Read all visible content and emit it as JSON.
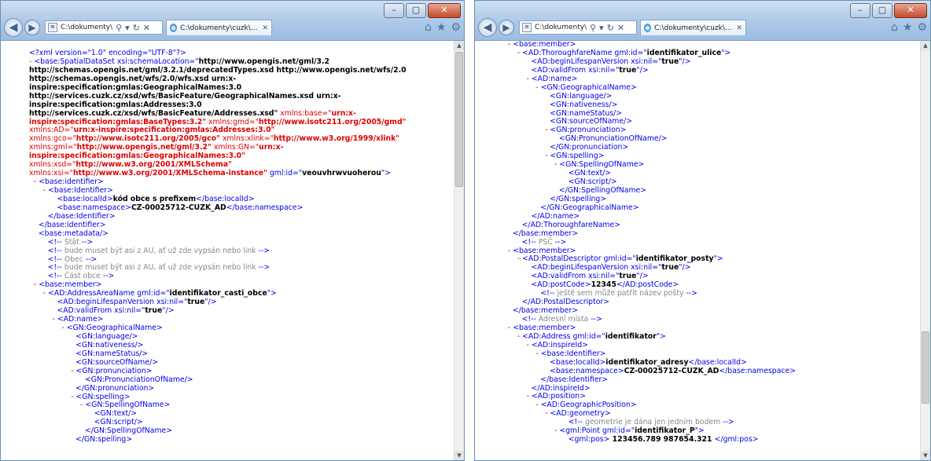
{
  "windows": {
    "left": {
      "address": "C:\\dokumenty\\",
      "tab_label": "C:\\dokumenty\\cuzk\\...",
      "lines": [
        [
          {
            "t": "<?xml version=\"1.0\" encoding=\"UTF-8\"?>",
            "c": "t"
          }
        ],
        [
          {
            "t": "- ",
            "c": "m"
          },
          {
            "t": "<base:SpatialDataSet xsi:schemaLocation=\"",
            "c": "t"
          },
          {
            "t": "http://www.opengis.net/gml/3.2",
            "c": "v"
          }
        ],
        [
          {
            "t": "http://schemas.opengis.net/gml/3.2.1/deprecatedTypes.xsd http://www.opengis.net/wfs/2.0",
            "c": "v"
          }
        ],
        [
          {
            "t": "http://schemas.opengis.net/wfs/2.0/wfs.xsd urn:x-",
            "c": "v"
          }
        ],
        [
          {
            "t": "inspire:specification:gmlas:GeographicalNames:3.0",
            "c": "v"
          }
        ],
        [
          {
            "t": "http://services.cuzk.cz/xsd/wfs/BasicFeature/GeographicalNames.xsd urn:x-",
            "c": "v"
          }
        ],
        [
          {
            "t": "inspire:specification:gmlas:Addresses:3.0",
            "c": "v"
          }
        ],
        [
          {
            "t": "http://services.cuzk.cz/xsd/wfs/BasicFeature/Addresses.xsd\"",
            "c": "v"
          },
          {
            "t": " xmlns:base=\"",
            "c": "m"
          },
          {
            "t": "urn:x-",
            "c": "a"
          }
        ],
        [
          {
            "t": "inspire:specification:gmlas:BaseTypes:3.2\"",
            "c": "a"
          },
          {
            "t": " xmlns:gmd=\"",
            "c": "m"
          },
          {
            "t": "http://www.isotc211.org/2005/gmd\"",
            "c": "a"
          }
        ],
        [
          {
            "t": "xmlns:AD=\"",
            "c": "m"
          },
          {
            "t": "urn:x-inspire:specification:gmlas:Addresses:3.0\"",
            "c": "a"
          }
        ],
        [
          {
            "t": "xmlns:gco=\"",
            "c": "m"
          },
          {
            "t": "http://www.isotc211.org/2005/gco\"",
            "c": "a"
          },
          {
            "t": " xmlns:xlink=\"",
            "c": "m"
          },
          {
            "t": "http://www.w3.org/1999/xlink\"",
            "c": "a"
          }
        ],
        [
          {
            "t": "xmlns:gml=\"",
            "c": "m"
          },
          {
            "t": "http://www.opengis.net/gml/3.2\"",
            "c": "a"
          },
          {
            "t": " xmlns:GN=\"",
            "c": "m"
          },
          {
            "t": "urn:x-",
            "c": "a"
          }
        ],
        [
          {
            "t": "inspire:specification:gmlas:GeographicalNames:3.0\"",
            "c": "a"
          }
        ],
        [
          {
            "t": "xmlns:xsd=\"",
            "c": "m"
          },
          {
            "t": "http://www.w3.org/2001/XMLSchema\"",
            "c": "a"
          }
        ],
        [
          {
            "t": "xmlns:xsi=\"",
            "c": "m"
          },
          {
            "t": "http://www.w3.org/2001/XMLSchema-instance\"",
            "c": "a"
          },
          {
            "t": " gml:id=\"",
            "c": "t"
          },
          {
            "t": "veouvhrwvuoherou",
            "c": "v"
          },
          {
            "t": "\">",
            "c": "t"
          }
        ],
        [
          {
            "t": "  - ",
            "c": "m"
          },
          {
            "t": "<base:identifier>",
            "c": "t"
          }
        ],
        [
          {
            "t": "      - ",
            "c": "m"
          },
          {
            "t": "<base:Identifier>",
            "c": "t"
          }
        ],
        [
          {
            "t": "            <base:localId>",
            "c": "t"
          },
          {
            "t": "kód obce s prefixem",
            "c": "v"
          },
          {
            "t": "</base:localId>",
            "c": "t"
          }
        ],
        [
          {
            "t": "            <base:namespace>",
            "c": "t"
          },
          {
            "t": "CZ-00025712-CUZK_AD",
            "c": "v"
          },
          {
            "t": "</base:namespace>",
            "c": "t"
          }
        ],
        [
          {
            "t": "        </base:Identifier>",
            "c": "t"
          }
        ],
        [
          {
            "t": "    </base:identifier>",
            "c": "t"
          }
        ],
        [
          {
            "t": "    <base:metadata/>",
            "c": "t"
          }
        ],
        [
          {
            "t": "        <!-- ",
            "c": "t"
          },
          {
            "t": "Stát",
            "c": "c"
          },
          {
            "t": " -->",
            "c": "t"
          }
        ],
        [
          {
            "t": "        <!-- ",
            "c": "t"
          },
          {
            "t": "bude muset být asi z AU, ať už zde vypsán nebo link",
            "c": "c"
          },
          {
            "t": " -->",
            "c": "t"
          }
        ],
        [
          {
            "t": "        <!-- ",
            "c": "t"
          },
          {
            "t": "Obec",
            "c": "c"
          },
          {
            "t": " -->",
            "c": "t"
          }
        ],
        [
          {
            "t": "        <!-- ",
            "c": "t"
          },
          {
            "t": "bude muset být asi z AU, ať už zde vypsán nebo link",
            "c": "c"
          },
          {
            "t": " -->",
            "c": "t"
          }
        ],
        [
          {
            "t": "        <!-- ",
            "c": "t"
          },
          {
            "t": "Část obce",
            "c": "c"
          },
          {
            "t": " -->",
            "c": "t"
          }
        ],
        [
          {
            "t": "  - ",
            "c": "m"
          },
          {
            "t": "<base:member>",
            "c": "t"
          }
        ],
        [
          {
            "t": "      - ",
            "c": "m"
          },
          {
            "t": "<AD:AddressAreaName gml:id=\"",
            "c": "t"
          },
          {
            "t": "identifikator_casti_obce",
            "c": "v"
          },
          {
            "t": "\">",
            "c": "t"
          }
        ],
        [
          {
            "t": "            <AD:beginLifespanVersion xsi:nil=\"",
            "c": "t"
          },
          {
            "t": "true",
            "c": "v"
          },
          {
            "t": "\"/>",
            "c": "t"
          }
        ],
        [
          {
            "t": "            <AD:validFrom xsi:nil=\"",
            "c": "t"
          },
          {
            "t": "true",
            "c": "v"
          },
          {
            "t": "\"/>",
            "c": "t"
          }
        ],
        [
          {
            "t": "          - ",
            "c": "m"
          },
          {
            "t": "<AD:name>",
            "c": "t"
          }
        ],
        [
          {
            "t": "              - ",
            "c": "m"
          },
          {
            "t": "<GN:GeographicalName>",
            "c": "t"
          }
        ],
        [
          {
            "t": "                    <GN:language/>",
            "c": "t"
          }
        ],
        [
          {
            "t": "                    <GN:nativeness/>",
            "c": "t"
          }
        ],
        [
          {
            "t": "                    <GN:nameStatus/>",
            "c": "t"
          }
        ],
        [
          {
            "t": "                    <GN:sourceOfName/>",
            "c": "t"
          }
        ],
        [
          {
            "t": "                  - ",
            "c": "m"
          },
          {
            "t": "<GN:pronunciation>",
            "c": "t"
          }
        ],
        [
          {
            "t": "                        <GN:PronunciationOfName/>",
            "c": "t"
          }
        ],
        [
          {
            "t": "                    </GN:pronunciation>",
            "c": "t"
          }
        ],
        [
          {
            "t": "                  - ",
            "c": "m"
          },
          {
            "t": "<GN:spelling>",
            "c": "t"
          }
        ],
        [
          {
            "t": "                      - ",
            "c": "m"
          },
          {
            "t": "<GN:SpellingOfName>",
            "c": "t"
          }
        ],
        [
          {
            "t": "                            <GN:text/>",
            "c": "t"
          }
        ],
        [
          {
            "t": "                            <GN:script/>",
            "c": "t"
          }
        ],
        [
          {
            "t": "                        </GN:SpellingOfName>",
            "c": "t"
          }
        ],
        [
          {
            "t": "                    </GN:spelling>",
            "c": "t"
          }
        ]
      ]
    },
    "right": {
      "address": "C:\\dokumenty\\",
      "tab_label": "C:\\dokumenty\\cuzk\\...",
      "lines": [
        [
          {
            "t": "  - ",
            "c": "m"
          },
          {
            "t": "<base:member>",
            "c": "t"
          }
        ],
        [
          {
            "t": "      - ",
            "c": "m"
          },
          {
            "t": "<AD:ThoroughfareName gml:id=\"",
            "c": "t"
          },
          {
            "t": "identifikator_ulice",
            "c": "v"
          },
          {
            "t": "\">",
            "c": "t"
          }
        ],
        [
          {
            "t": "            <AD:beginLifespanVersion xsi:nil=\"",
            "c": "t"
          },
          {
            "t": "true",
            "c": "v"
          },
          {
            "t": "\"/>",
            "c": "t"
          }
        ],
        [
          {
            "t": "            <AD:validFrom xsi:nil=\"",
            "c": "t"
          },
          {
            "t": "true",
            "c": "v"
          },
          {
            "t": "\"/>",
            "c": "t"
          }
        ],
        [
          {
            "t": "          - ",
            "c": "m"
          },
          {
            "t": "<AD:name>",
            "c": "t"
          }
        ],
        [
          {
            "t": "              - ",
            "c": "m"
          },
          {
            "t": "<GN:GeographicalName>",
            "c": "t"
          }
        ],
        [
          {
            "t": "                    <GN:language/>",
            "c": "t"
          }
        ],
        [
          {
            "t": "                    <GN:nativeness/>",
            "c": "t"
          }
        ],
        [
          {
            "t": "                    <GN:nameStatus/>",
            "c": "t"
          }
        ],
        [
          {
            "t": "                    <GN:sourceOfName/>",
            "c": "t"
          }
        ],
        [
          {
            "t": "                  - ",
            "c": "m"
          },
          {
            "t": "<GN:pronunciation>",
            "c": "t"
          }
        ],
        [
          {
            "t": "                        <GN:PronunciationOfName/>",
            "c": "t"
          }
        ],
        [
          {
            "t": "                    </GN:pronunciation>",
            "c": "t"
          }
        ],
        [
          {
            "t": "                  - ",
            "c": "m"
          },
          {
            "t": "<GN:spelling>",
            "c": "t"
          }
        ],
        [
          {
            "t": "                      - ",
            "c": "m"
          },
          {
            "t": "<GN:SpellingOfName>",
            "c": "t"
          }
        ],
        [
          {
            "t": "                            <GN:text/>",
            "c": "t"
          }
        ],
        [
          {
            "t": "                            <GN:script/>",
            "c": "t"
          }
        ],
        [
          {
            "t": "                        </GN:SpellingOfName>",
            "c": "t"
          }
        ],
        [
          {
            "t": "                    </GN:spelling>",
            "c": "t"
          }
        ],
        [
          {
            "t": "                </GN:GeographicalName>",
            "c": "t"
          }
        ],
        [
          {
            "t": "            </AD:name>",
            "c": "t"
          }
        ],
        [
          {
            "t": "        </AD:ThoroughfareName>",
            "c": "t"
          }
        ],
        [
          {
            "t": "    </base:member>",
            "c": "t"
          }
        ],
        [
          {
            "t": "        <!-- ",
            "c": "t"
          },
          {
            "t": "PSČ",
            "c": "c"
          },
          {
            "t": " -->",
            "c": "t"
          }
        ],
        [
          {
            "t": "  - ",
            "c": "m"
          },
          {
            "t": "<base:member>",
            "c": "t"
          }
        ],
        [
          {
            "t": "      - ",
            "c": "m"
          },
          {
            "t": "<AD:PostalDescriptor gml:id=\"",
            "c": "t"
          },
          {
            "t": "identifikator_posty",
            "c": "v"
          },
          {
            "t": "\">",
            "c": "t"
          }
        ],
        [
          {
            "t": "            <AD:beginLifespanVersion xsi:nil=\"",
            "c": "t"
          },
          {
            "t": "true",
            "c": "v"
          },
          {
            "t": "\"/>",
            "c": "t"
          }
        ],
        [
          {
            "t": "            <AD:validFrom xsi:nil=\"",
            "c": "t"
          },
          {
            "t": "true",
            "c": "v"
          },
          {
            "t": "\"/>",
            "c": "t"
          }
        ],
        [
          {
            "t": "            <AD:postCode>",
            "c": "t"
          },
          {
            "t": "12345",
            "c": "v"
          },
          {
            "t": "</AD:postCode>",
            "c": "t"
          }
        ],
        [
          {
            "t": "                <!-- ",
            "c": "t"
          },
          {
            "t": "ještě sem může patřit název pošty",
            "c": "c"
          },
          {
            "t": " -->",
            "c": "t"
          }
        ],
        [
          {
            "t": "        </AD:PostalDescriptor>",
            "c": "t"
          }
        ],
        [
          {
            "t": "    </base:member>",
            "c": "t"
          }
        ],
        [
          {
            "t": "        <!-- ",
            "c": "t"
          },
          {
            "t": "Adresní místa",
            "c": "c"
          },
          {
            "t": " -->",
            "c": "t"
          }
        ],
        [
          {
            "t": "  - ",
            "c": "m"
          },
          {
            "t": "<base:member>",
            "c": "t"
          }
        ],
        [
          {
            "t": "      - ",
            "c": "m"
          },
          {
            "t": "<AD:Address gml:id=\"",
            "c": "t"
          },
          {
            "t": "identifikator",
            "c": "v"
          },
          {
            "t": "\">",
            "c": "t"
          }
        ],
        [
          {
            "t": "          - ",
            "c": "m"
          },
          {
            "t": "<AD:inspireId>",
            "c": "t"
          }
        ],
        [
          {
            "t": "              - ",
            "c": "m"
          },
          {
            "t": "<base:Identifier>",
            "c": "t"
          }
        ],
        [
          {
            "t": "                    <base:localId>",
            "c": "t"
          },
          {
            "t": "identifikator_adresy",
            "c": "v"
          },
          {
            "t": "</base:localId>",
            "c": "t"
          }
        ],
        [
          {
            "t": "                    <base:namespace>",
            "c": "t"
          },
          {
            "t": "CZ-00025712-CUZK_AD",
            "c": "v"
          },
          {
            "t": "</base:namespace>",
            "c": "t"
          }
        ],
        [
          {
            "t": "                </base:Identifier>",
            "c": "t"
          }
        ],
        [
          {
            "t": "            </AD:inspireId>",
            "c": "t"
          }
        ],
        [
          {
            "t": "          - ",
            "c": "m"
          },
          {
            "t": "<AD:position>",
            "c": "t"
          }
        ],
        [
          {
            "t": "              - ",
            "c": "m"
          },
          {
            "t": "<AD:GeographicPosition>",
            "c": "t"
          }
        ],
        [
          {
            "t": "                  - ",
            "c": "m"
          },
          {
            "t": "<AD:geometry>",
            "c": "t"
          }
        ],
        [
          {
            "t": "                            <!-- ",
            "c": "t"
          },
          {
            "t": "geometrie je dána jen jedním bodem",
            "c": "c"
          },
          {
            "t": " -->",
            "c": "t"
          }
        ],
        [
          {
            "t": "                      - ",
            "c": "m"
          },
          {
            "t": "<gml:Point gml:id=\"",
            "c": "t"
          },
          {
            "t": "identifikator_P",
            "c": "v"
          },
          {
            "t": "\">",
            "c": "t"
          }
        ],
        [
          {
            "t": "                            <gml:pos>",
            "c": "t"
          },
          {
            "t": " 123456.789 987654.321 ",
            "c": "v"
          },
          {
            "t": "</gml:pos>",
            "c": "t"
          }
        ]
      ]
    }
  }
}
